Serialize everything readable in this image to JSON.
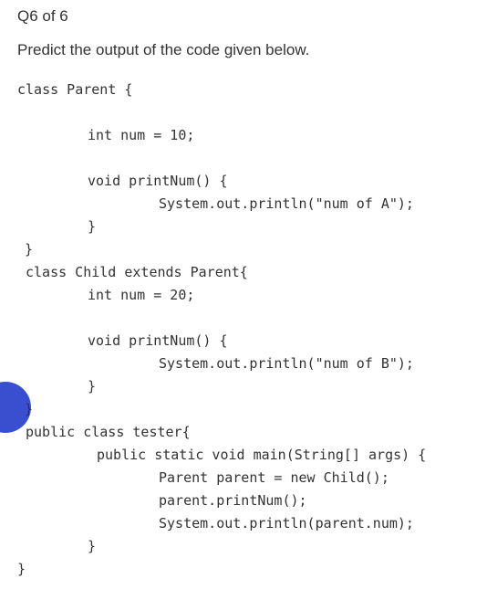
{
  "question": {
    "counter": "Q6 of 6",
    "prompt": "Predict the output of the code given below."
  },
  "code": {
    "l1": "class Parent {",
    "l2": "int num = 10;",
    "l3": "void printNum() {",
    "l4": "System.out.println(\"num of A\");",
    "l5": "}",
    "l6": "}",
    "l7": "class Child extends Parent{",
    "l8": "int num = 20;",
    "l9": "void printNum() {",
    "l10": "System.out.println(\"num of B\");",
    "l11": "}",
    "l12": "}",
    "l13": "public class tester{",
    "l14": "public static void main(String[] args) {",
    "l15": "Parent parent = new Child();",
    "l16": "parent.printNum();",
    "l17": "System.out.println(parent.num);",
    "l18": "}",
    "l19": "}"
  }
}
